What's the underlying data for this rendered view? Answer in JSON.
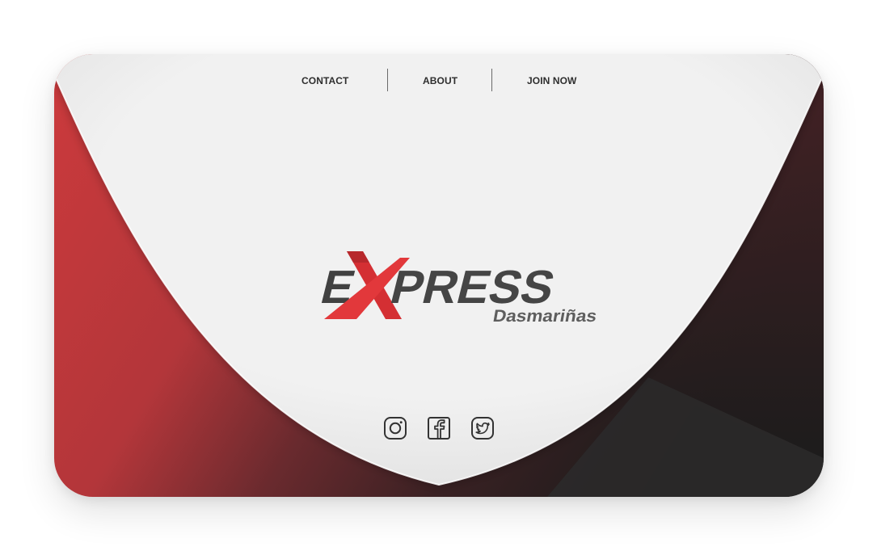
{
  "nav": {
    "contact": "CONTACT",
    "about": "ABOUT",
    "join": "JOIN NOW"
  },
  "logo": {
    "e": "E",
    "x": "X",
    "press": "PRESS",
    "subtitle": "Dasmariñas"
  },
  "social": {
    "instagram": "instagram-icon",
    "facebook": "facebook-icon",
    "twitter": "twitter-icon"
  },
  "colors": {
    "red": "#c8383a",
    "dark": "#1f1f1f",
    "panel": "#f0f0f0",
    "text": "#2e2e2e"
  }
}
